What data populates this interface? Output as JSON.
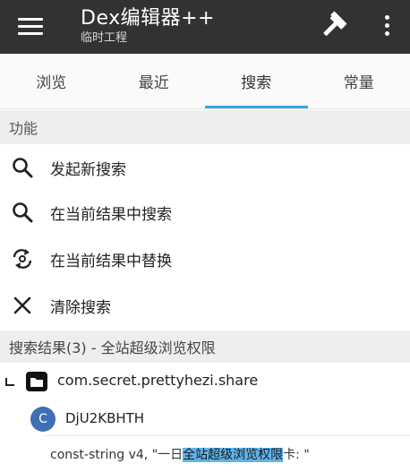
{
  "appbar": {
    "title": "Dex编辑器++",
    "subtitle": "临时工程"
  },
  "tabs": [
    {
      "label": "浏览",
      "active": false
    },
    {
      "label": "最近",
      "active": false
    },
    {
      "label": "搜索",
      "active": true
    },
    {
      "label": "常量",
      "active": false
    }
  ],
  "functions": {
    "header": "功能",
    "items": [
      {
        "label": "发起新搜索",
        "icon": "search-icon"
      },
      {
        "label": "在当前结果中搜索",
        "icon": "search-icon"
      },
      {
        "label": "在当前结果中替换",
        "icon": "replace-icon"
      },
      {
        "label": "清除搜索",
        "icon": "close-icon"
      }
    ]
  },
  "results": {
    "header": "搜索结果(3) - 全站超级浏览权限",
    "package": "com.secret.prettyhezi.share",
    "class_badge": "C",
    "class_name": "DjU2KBHTH",
    "line_prefix": "const-string v4, \"一日",
    "line_highlight": "全站超级浏览权限",
    "line_suffix": "卡: \""
  },
  "colors": {
    "appbar": "#323232",
    "accent": "#35a8e0",
    "highlight": "#5fb4ec",
    "class_badge": "#3f6fb5"
  }
}
